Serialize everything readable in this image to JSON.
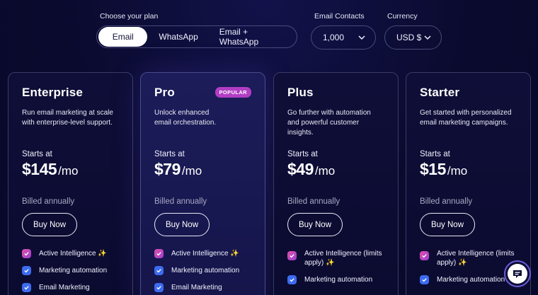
{
  "controls": {
    "plan_label": "Choose your plan",
    "plan_options": [
      "Email",
      "WhatsApp",
      "Email + WhatsApp"
    ],
    "plan_selected": "Email",
    "contacts_label": "Email Contacts",
    "contacts_value": "1,000",
    "currency_label": "Currency",
    "currency_value": "USD $"
  },
  "cards": [
    {
      "name": "Enterprise",
      "desc": "Run email marketing at scale with enterprise-level support.",
      "starts": "Starts at",
      "price": "$145",
      "per": "/mo",
      "billed": "Billed annually",
      "cta": "Buy Now",
      "features": [
        "Active Intelligence ✨",
        "Marketing automation",
        "Email Marketing"
      ]
    },
    {
      "name": "Pro",
      "badge": "POPULAR",
      "desc": "Unlock enhanced email orchestration.",
      "starts": "Starts at",
      "price": "$79",
      "per": "/mo",
      "billed": "Billed annually",
      "cta": "Buy Now",
      "features": [
        "Active Intelligence ✨",
        "Marketing automation",
        "Email Marketing"
      ]
    },
    {
      "name": "Plus",
      "desc": "Go further with automation and powerful customer insights.",
      "starts": "Starts at",
      "price": "$49",
      "per": "/mo",
      "billed": "Billed annually",
      "cta": "Buy Now",
      "features": [
        "Active Intelligence (limits apply) ✨",
        "Marketing automation"
      ]
    },
    {
      "name": "Starter",
      "desc": "Get started with personalized email marketing campaigns.",
      "starts": "Starts at",
      "price": "$15",
      "per": "/mo",
      "billed": "Billed annually",
      "cta": "Buy Now",
      "features": [
        "Active Intelligence (limits apply) ✨",
        "Marketing automation"
      ]
    }
  ],
  "colors": {
    "background": "#0a0a2e",
    "badge": "#b13ec3",
    "check_pink": "#e04fa8",
    "check_blue": "#3d6bf0"
  },
  "icons": {
    "dropdown": "chevron-down-icon",
    "feature": "check-icon",
    "chat": "chat-icon"
  }
}
